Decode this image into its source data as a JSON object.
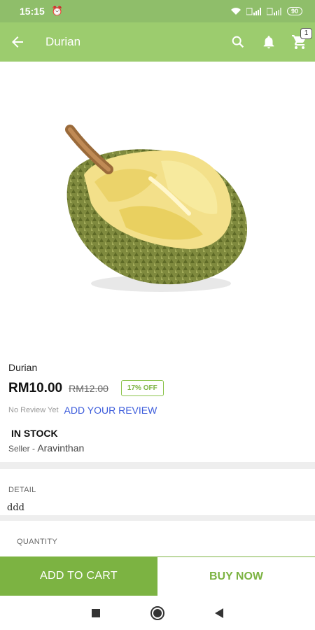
{
  "status_bar": {
    "time": "15:15",
    "battery": "90"
  },
  "app_bar": {
    "title": "Durian",
    "cart_count": "1"
  },
  "product": {
    "name": "Durian",
    "price": "RM10.00",
    "old_price": "RM12.00",
    "discount": "17% OFF",
    "no_review": "No Review Yet",
    "add_review": "ADD YOUR REVIEW",
    "stock": "IN STOCK",
    "seller_label": "Seller - ",
    "seller_name": "Aravinthan"
  },
  "detail": {
    "label": "DETAIL",
    "text": "ddd"
  },
  "quantity": {
    "label": "QUANTITY"
  },
  "actions": {
    "add_to_cart": "ADD TO CART",
    "buy_now": "BUY NOW"
  },
  "colors": {
    "app_bar": "#9ccc6e",
    "status_bar": "#8fbe6a",
    "primary": "#7cb342",
    "link": "#3b5bdb"
  }
}
